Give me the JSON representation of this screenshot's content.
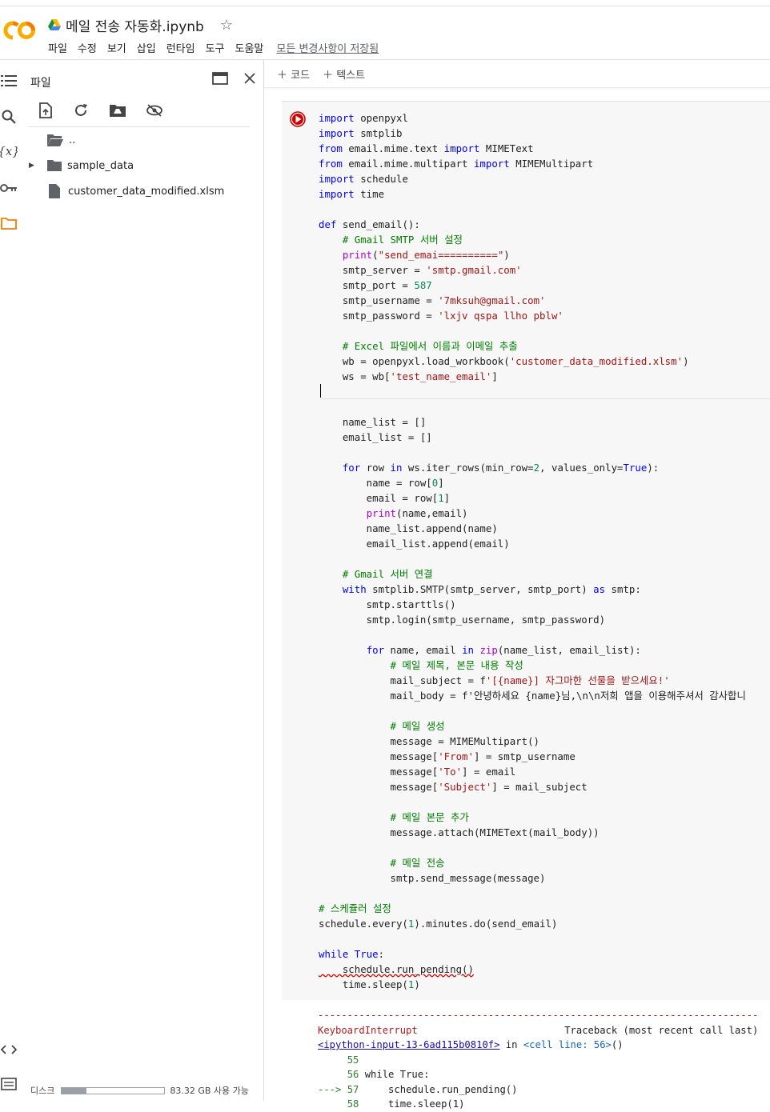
{
  "header": {
    "title": "메일 전송 자동화.ipynb",
    "menu": [
      "파일",
      "수정",
      "보기",
      "삽입",
      "런타임",
      "도구",
      "도움말"
    ],
    "saved_status": "모든 변경사항이 저장됨"
  },
  "panel": {
    "title": "파일",
    "tree": [
      {
        "name": "..",
        "type": "folder"
      },
      {
        "name": "sample_data",
        "type": "folder"
      },
      {
        "name": "customer_data_modified.xlsm",
        "type": "file"
      }
    ],
    "disk_label": "디스크",
    "disk_usage": "83.32 GB 사용 가능",
    "disk_fill_fraction": 0.24
  },
  "toolbar": {
    "add_code": "＋ 코드",
    "add_text": "＋ 텍스트"
  },
  "colors": {
    "run_button": "#d50000",
    "folder": "#5f6368",
    "logo_orange": "#f9ab00",
    "logo_yellow": "#f57c00"
  },
  "code_lines": [
    "import openpyxl",
    "import smtplib",
    "from email.mime.text import MIMEText",
    "from email.mime.multipart import MIMEMultipart",
    "import schedule",
    "import time",
    "",
    "def send_email():",
    "    # Gmail SMTP 서버 설정",
    "    print(\"send_emai==========\")",
    "    smtp_server = 'smtp.gmail.com'",
    "    smtp_port = 587",
    "    smtp_username = '7mksuh@gmail.com'",
    "    smtp_password = 'lxjv qspa llho pblw'",
    "",
    "    # Excel 파일에서 이름과 이메일 추출",
    "    wb = openpyxl.load_workbook('customer_data_modified.xlsm')",
    "    ws = wb['test_name_email']",
    "",
    "",
    "    name_list = []",
    "    email_list = []",
    "",
    "    for row in ws.iter_rows(min_row=2, values_only=True):",
    "        name = row[0]",
    "        email = row[1]",
    "        print(name,email)",
    "        name_list.append(name)",
    "        email_list.append(email)",
    "",
    "    # Gmail 서버 연결",
    "    with smtplib.SMTP(smtp_server, smtp_port) as smtp:",
    "        smtp.starttls()",
    "        smtp.login(smtp_username, smtp_password)",
    "",
    "        for name, email in zip(name_list, email_list):",
    "            # 메일 제목, 본문 내용 작성",
    "            mail_subject = f'[{name}] 자그마한 선물을 받으세요!'",
    "            mail_body = f'안녕하세요 {name}님,\\n\\n저희 앱을 이용해주셔서 감사합니",
    "",
    "            # 메일 생성",
    "            message = MIMEMultipart()",
    "            message['From'] = smtp_username",
    "            message['To'] = email",
    "            message['Subject'] = mail_subject",
    "",
    "            # 메일 본문 추가",
    "            message.attach(MIMEText(mail_body))",
    "",
    "            # 메일 전송",
    "            smtp.send_message(message)",
    "",
    "# 스케쥴러 설정",
    "schedule.every(1).minutes.do(send_email)",
    "",
    "while True:",
    "    schedule.run_pending()",
    "    time.sleep(1)"
  ],
  "output": {
    "dashes": "---------------------------------------------------------------------------",
    "error_name": "KeyboardInterrupt",
    "traceback_label": "Traceback (most recent call last)",
    "input_link": "<ipython-input-13-6ad115b0810f>",
    "in_text": " in ",
    "cell_ref": "<cell line: 56>",
    "call_suffix": "()",
    "lines": [
      {
        "prefix": "     ",
        "num": "55",
        "code": ""
      },
      {
        "prefix": "     ",
        "num": "56",
        "code": " while True:"
      },
      {
        "prefix": "---> ",
        "num": "57",
        "code": "     schedule.run_pending()"
      },
      {
        "prefix": "     ",
        "num": "58",
        "code": "     time.sleep(1)"
      }
    ]
  }
}
